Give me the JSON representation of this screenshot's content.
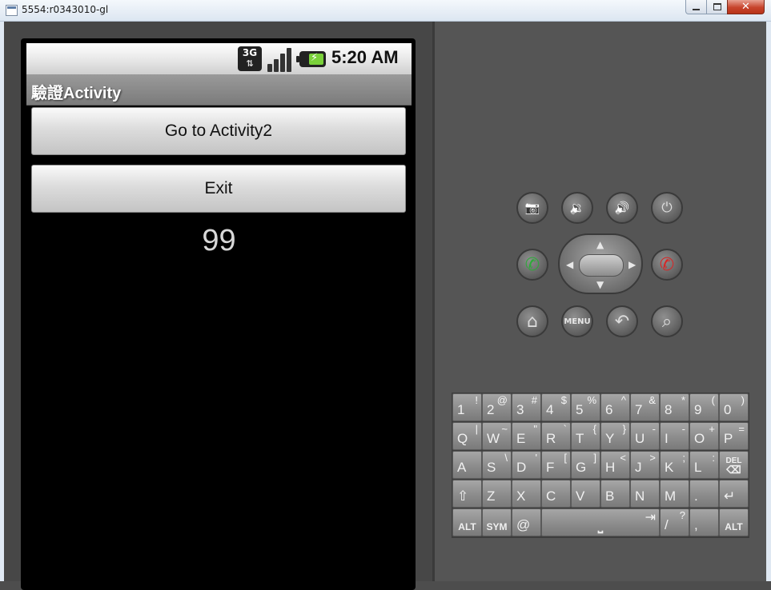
{
  "window": {
    "title": "5554:r0343010-gl",
    "min_icon": "minimize-icon",
    "max_icon": "maximize-icon",
    "close_icon": "close-icon",
    "close_glyph": "✕"
  },
  "statusbar": {
    "network": "3G",
    "network_arrows": "⇅",
    "time": "5:20 AM",
    "battery_bolt": "⚡"
  },
  "app": {
    "title": "驗證Activity",
    "buttons": {
      "go_label": "Go to Activity2",
      "exit_label": "Exit"
    },
    "counter": "99"
  },
  "controls": {
    "menu_label": "MENU",
    "camera_glyph": "📷",
    "vol_down_glyph": "🔉",
    "vol_up_glyph": "🔊",
    "power_glyph": "⏻",
    "call_glyph": "✆",
    "end_glyph": "✆",
    "home_glyph": "⌂",
    "back_glyph": "↶",
    "search_glyph": "⌕",
    "dpad": {
      "up": "▲",
      "down": "▼",
      "left": "◀",
      "right": "▶"
    }
  },
  "keyboard": {
    "rows": [
      [
        {
          "m": "1",
          "a": "!"
        },
        {
          "m": "2",
          "a": "@"
        },
        {
          "m": "3",
          "a": "#"
        },
        {
          "m": "4",
          "a": "$"
        },
        {
          "m": "5",
          "a": "%"
        },
        {
          "m": "6",
          "a": "^"
        },
        {
          "m": "7",
          "a": "&"
        },
        {
          "m": "8",
          "a": "*"
        },
        {
          "m": "9",
          "a": "("
        },
        {
          "m": "0",
          "a": ")"
        }
      ],
      [
        {
          "m": "Q",
          "a": "|"
        },
        {
          "m": "W",
          "a": "~"
        },
        {
          "m": "E",
          "a": "\""
        },
        {
          "m": "R",
          "a": "`"
        },
        {
          "m": "T",
          "a": "{"
        },
        {
          "m": "Y",
          "a": "}"
        },
        {
          "m": "U",
          "a": "-"
        },
        {
          "m": "I",
          "a": "-"
        },
        {
          "m": "O",
          "a": "+"
        },
        {
          "m": "P",
          "a": "="
        }
      ],
      [
        {
          "m": "A",
          "a": ""
        },
        {
          "m": "S",
          "a": "\\"
        },
        {
          "m": "D",
          "a": "'"
        },
        {
          "m": "F",
          "a": "["
        },
        {
          "m": "G",
          "a": "]"
        },
        {
          "m": "H",
          "a": "<"
        },
        {
          "m": "J",
          "a": ">"
        },
        {
          "m": "K",
          "a": ";"
        },
        {
          "m": "L",
          "a": ":"
        },
        {
          "m": "DEL",
          "a": "⌫",
          "special": true
        }
      ],
      [
        {
          "m": "⇧",
          "a": ""
        },
        {
          "m": "Z",
          "a": ""
        },
        {
          "m": "X",
          "a": ""
        },
        {
          "m": "C",
          "a": ""
        },
        {
          "m": "V",
          "a": ""
        },
        {
          "m": "B",
          "a": ""
        },
        {
          "m": "N",
          "a": ""
        },
        {
          "m": "M",
          "a": ""
        },
        {
          "m": ".",
          "a": ""
        },
        {
          "m": "↵",
          "a": ""
        }
      ]
    ],
    "bottom": {
      "alt_left": "ALT",
      "sym": "SYM",
      "at": "@",
      "space": "⎵",
      "tab": "⇥",
      "slash": "/",
      "question": "?",
      "comma": ",",
      "alt_right": "ALT"
    }
  }
}
